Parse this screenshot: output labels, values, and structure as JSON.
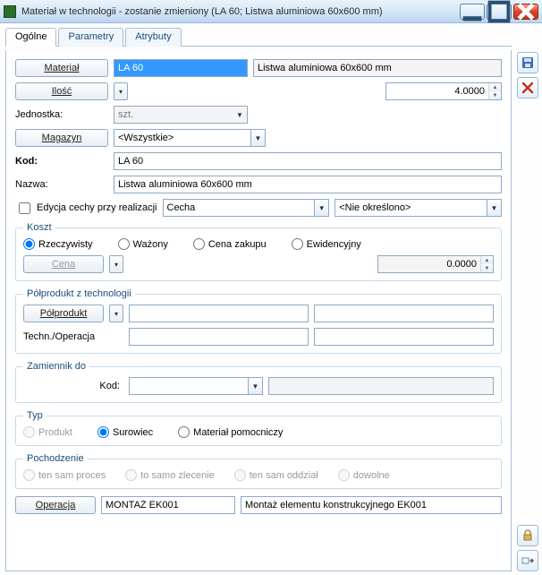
{
  "window": {
    "title": "Materiał w technologii - zostanie zmieniony  (LA 60; Listwa aluminiowa 60x600 mm)"
  },
  "tabs": {
    "general": "Ogólne",
    "params": "Parametry",
    "attrs": "Atrybuty"
  },
  "labels": {
    "material_btn": "Materiał",
    "qty_btn": "Ilość",
    "unit": "Jednostka:",
    "warehouse_btn": "Magazyn",
    "code": "Kod:",
    "name": "Nazwa:",
    "edit_attr": "Edycja cechy przy realizacji",
    "cost_legend": "Koszt",
    "real": "Rzeczywisty",
    "weighted": "Ważony",
    "purchase": "Cena zakupu",
    "evidence": "Ewidencyjny",
    "price_btn": "Cena",
    "semi_legend": "Półprodukt z technologii",
    "semi_btn": "Półprodukt",
    "tech_op": "Techn./Operacja",
    "subst_legend": "Zamiennik do",
    "subst_code": "Kod:",
    "type_legend": "Typ",
    "type_product": "Produkt",
    "type_raw": "Surowiec",
    "type_aux": "Materiał pomocniczy",
    "origin_legend": "Pochodzenie",
    "origin_same_proc": "ten sam proces",
    "origin_same_order": "to samo zlecenie",
    "origin_same_dept": "ten sam oddział",
    "origin_any": "dowolne",
    "operation_btn": "Operacja"
  },
  "values": {
    "material_code": "LA 60",
    "material_desc": "Listwa aluminiowa 60x600 mm",
    "quantity": "4.0000",
    "unit": "szt.",
    "warehouse": "<Wszystkie>",
    "code": "LA 60",
    "name": "Listwa aluminiowa 60x600 mm",
    "attr_kind": "Cecha",
    "attr_value": "<Nie określono>",
    "cost_value": "0.0000",
    "operation_code": "MONTAŻ EK001",
    "operation_name": "Montaż elementu konstrukcyjnego EK001"
  }
}
